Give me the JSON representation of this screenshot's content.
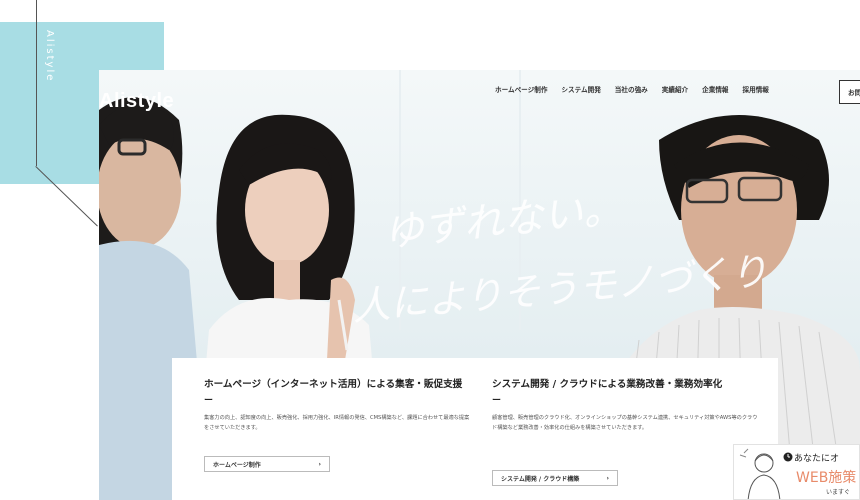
{
  "side": {
    "label": "Alistyle"
  },
  "header": {
    "logo": "Alistyle",
    "nav": [
      "ホームページ制作",
      "システム開発",
      "当社の強み",
      "実績紹介",
      "企業情報",
      "採用情報"
    ],
    "contact_label": "お問"
  },
  "hero": {
    "slogan_line1": "ゆずれない。",
    "slogan_line2": "人によりそうモノづくり"
  },
  "services": [
    {
      "title": "ホームページ（インターネット活用）による集客・販促支援",
      "dash": "ー",
      "desc": "集客力の向上、認知度の向上、販売強化、採用力強化、IR情報の発信、CMS構築など、課題に合わせて最適な提案をさせていただきます。",
      "button": "ホームページ制作"
    },
    {
      "title": "システム開発 / クラウドによる業務改善・業務効率化",
      "dash": "ー",
      "desc": "顧客管理、販売管理のクラウド化、オンラインショップの基幹システム連携、セキュリティ対策やAWS等のクラウド構築など業務改善・効率化の仕組みを構築させていただきます。",
      "button": "システム開発 / クラウド構築"
    }
  ],
  "banner": {
    "line1": "あなたにオ",
    "line2": "WEB施策",
    "line3": "いますぐ"
  },
  "colors": {
    "accent_cyan": "#a8dde4",
    "banner_orange": "#e88b6a"
  },
  "icons": [
    "arrow-right-icon",
    "person-illustration-icon",
    "clock-icon"
  ]
}
